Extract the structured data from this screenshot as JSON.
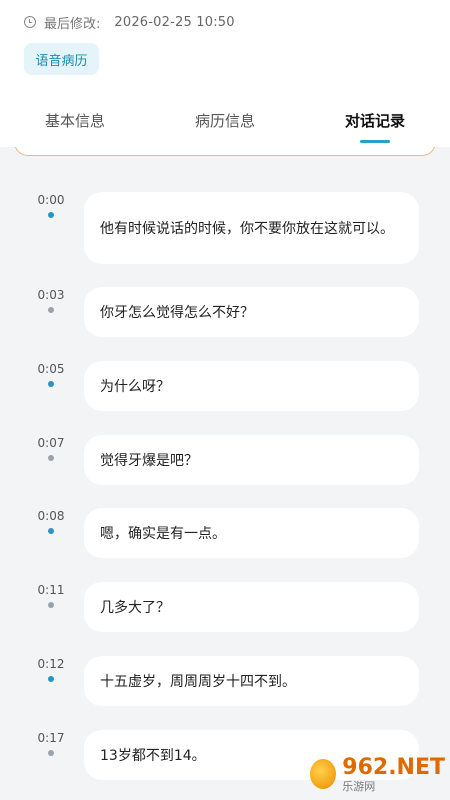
{
  "header": {
    "modified_label": "最后修改:",
    "modified_time": "2026-02-25 10:50",
    "badge_label": "语音病历"
  },
  "tabs": [
    {
      "label": "基本信息",
      "active": false
    },
    {
      "label": "病历信息",
      "active": false
    },
    {
      "label": "对话记录",
      "active": true
    }
  ],
  "transcript": [
    {
      "time": "0:00",
      "text": "他有时候说话的时候，你不要你放在这就可以。",
      "speaker": "blue"
    },
    {
      "time": "0:03",
      "text": "你牙怎么觉得怎么不好？",
      "speaker": "gray"
    },
    {
      "time": "0:05",
      "text": "为什么呀？",
      "speaker": "blue"
    },
    {
      "time": "0:07",
      "text": "觉得牙爆是吧？",
      "speaker": "gray"
    },
    {
      "time": "0:08",
      "text": "嗯，确实是有一点。",
      "speaker": "blue"
    },
    {
      "time": "0:11",
      "text": "几多大了？",
      "speaker": "gray"
    },
    {
      "time": "0:12",
      "text": "十五虚岁，周周周岁十四不到。",
      "speaker": "blue"
    },
    {
      "time": "0:17",
      "text": "13岁都不到14。",
      "speaker": "gray"
    }
  ],
  "colors": {
    "accent": "#2aa0c8",
    "speaker_blue": "#2a93c4",
    "speaker_gray": "#9aa3ad"
  },
  "watermark": {
    "main": "962.NET",
    "sub": "乐游网"
  }
}
